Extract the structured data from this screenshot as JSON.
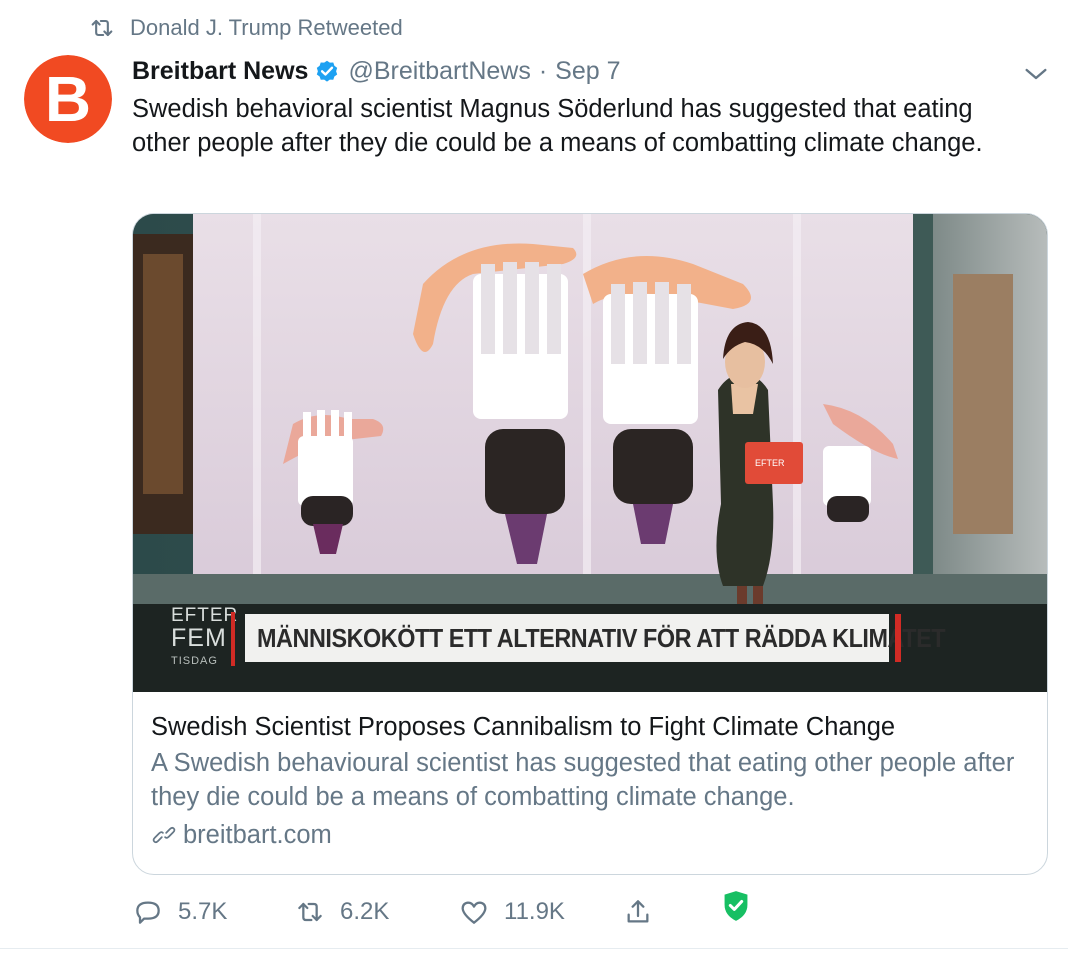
{
  "retweet": {
    "label": "Donald J. Trump Retweeted",
    "icon": "retweet-icon"
  },
  "author": {
    "name": "Breitbart News",
    "handle": "@BreitbartNews",
    "separator": "·",
    "date": "Sep 7",
    "avatar_letter": "B",
    "avatar_color": "#f14a22",
    "verified": true,
    "verified_color": "#1da1f2"
  },
  "tweet": {
    "text": "Swedish behavioral scientist Magnus Söderlund has suggested that eating other people after they die could be a means of combatting climate change."
  },
  "card": {
    "image": {
      "logo_line1": "EFTER",
      "logo_line2": "FEM",
      "logo_line3": "TISDAG",
      "headline": "MÄNNISKOKÖTT ETT ALTERNATIV FÖR ATT RÄDDA KLIMATET",
      "accent_color": "#d12b25"
    },
    "title": "Swedish Scientist Proposes Cannibalism to Fight Climate Change",
    "description": "A Swedish behavioural scientist has suggested that eating other people after they die could be a means of combatting climate change.",
    "domain": "breitbart.com"
  },
  "actions": {
    "replies": "5.7K",
    "retweets": "6.2K",
    "likes": "11.9K",
    "shield_color": "#17bf63"
  }
}
